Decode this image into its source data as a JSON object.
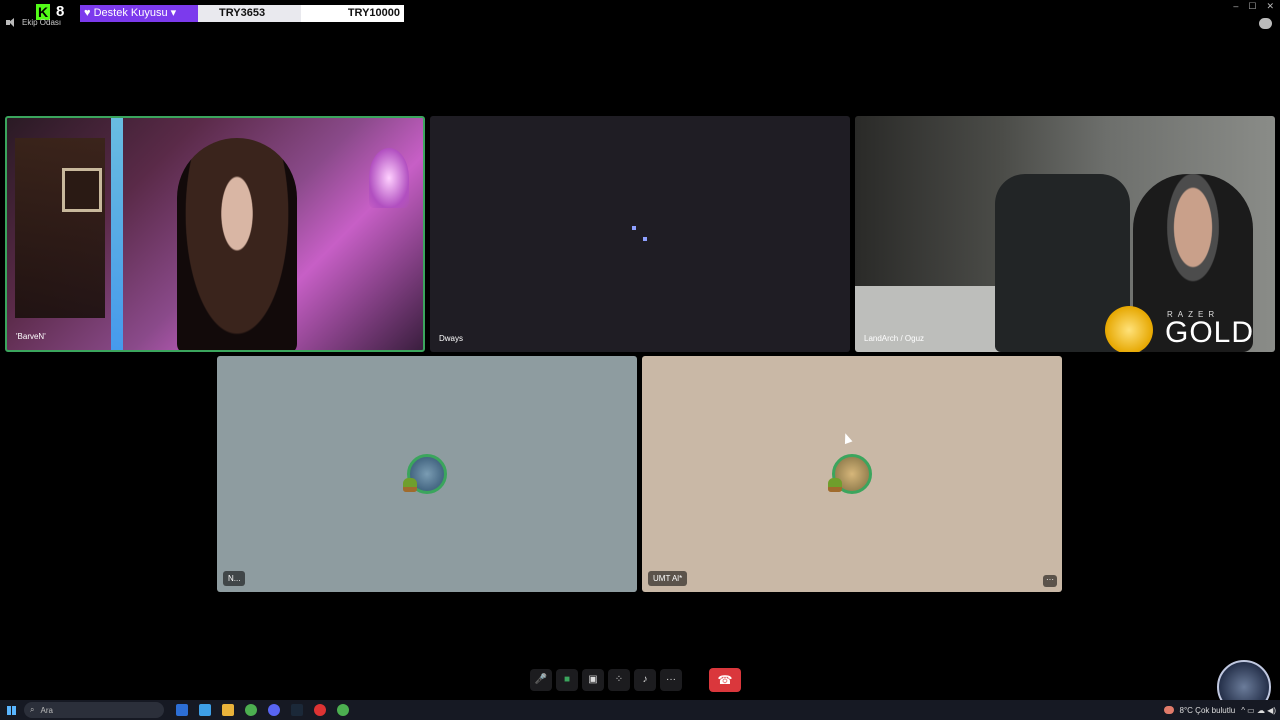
{
  "overlay": {
    "kick_count": "8",
    "goal_label": "♥ Destek Kuyusu ▾",
    "current_amount": "TRY3653",
    "target_amount": "TRY10000",
    "room_name": "Ekip Odası"
  },
  "window": {
    "minimize": "–",
    "maximize": "☐",
    "close": "✕"
  },
  "tiles": [
    {
      "name": "'BarveN'",
      "speaking": true
    },
    {
      "name": "Dways"
    },
    {
      "name": "LandArch / Oguz"
    },
    {
      "name": "N..."
    },
    {
      "name": "UMT Al*",
      "muted": true
    }
  ],
  "sponsor": {
    "brand": "RAZER",
    "product": "GOLD"
  },
  "controls": {
    "mic": "🎤",
    "camera": "■",
    "share": "▣",
    "activities": "⁘",
    "soundboard": "♪",
    "more": "···",
    "hangup": "☎",
    "tile_more": "···"
  },
  "taskbar": {
    "search_placeholder": "Ara",
    "weather": "8°C  Çok bulutlu",
    "tray_icons": "^ ▭ ☁ ◀)"
  },
  "colors": {
    "speaking_ring": "#3ba55d",
    "hangup": "#da373c",
    "goal_purple": "#7c3aed",
    "kick_green": "#53fc18"
  }
}
